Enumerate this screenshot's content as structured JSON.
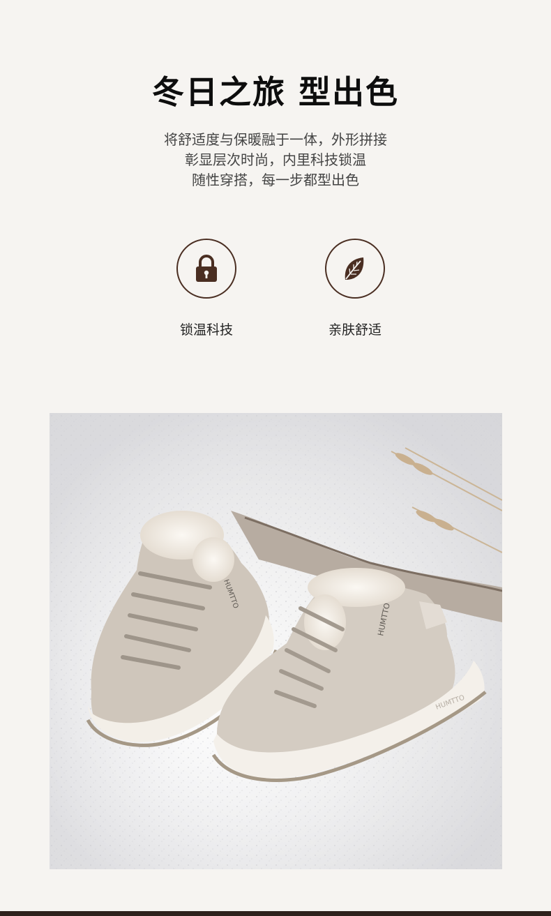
{
  "header": {
    "title": "冬日之旅 型出色",
    "subtitle_lines": [
      "将舒适度与保暖融于一体，外形拼接",
      "彰显层次时尚，内里科技锁温",
      "随性穿搭，每一步都型出色"
    ]
  },
  "features": [
    {
      "icon": "padlock-icon",
      "label": "锁温科技"
    },
    {
      "icon": "leaf-icon",
      "label": "亲肤舒适"
    }
  ],
  "product_photo": {
    "brand_text": "HUMTTO",
    "colors": {
      "accent": "#4a2e22",
      "shoe": "#cfc7bd",
      "sole": "#f1ede6"
    }
  }
}
